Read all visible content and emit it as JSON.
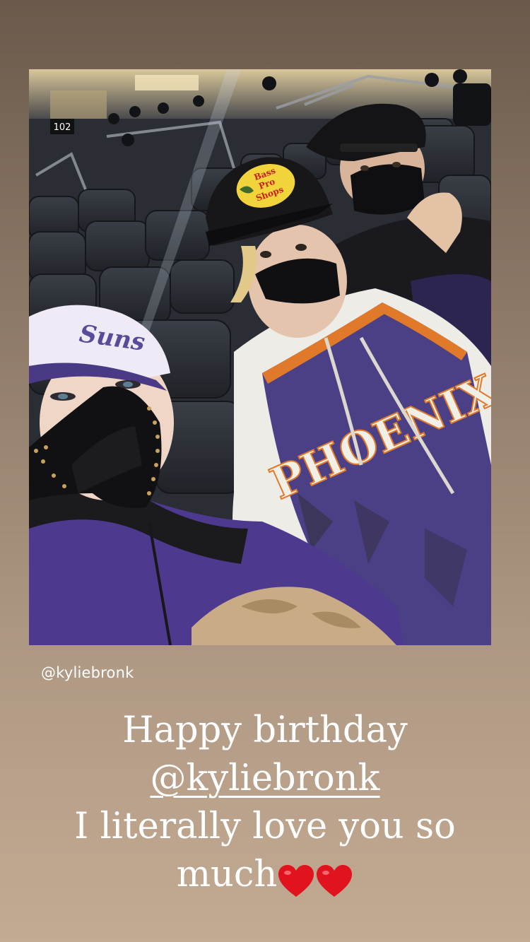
{
  "story": {
    "mention_sticker": "@kyliebronk",
    "caption": {
      "line1": "Happy birthday",
      "mention": "@kyliebronk",
      "line3": "I literally love you so",
      "line4": "much",
      "emoji": [
        "heart-emoji",
        "heart-emoji"
      ]
    }
  },
  "photo": {
    "section_sign": "102",
    "cap_logo": [
      "Bass",
      "Pro",
      "Shops"
    ],
    "jersey_text": "PHOENIX",
    "colors": {
      "jersey_purple": "#4b3f86",
      "jersey_orange": "#e07a2a",
      "heart_red": "#e0131f"
    }
  }
}
